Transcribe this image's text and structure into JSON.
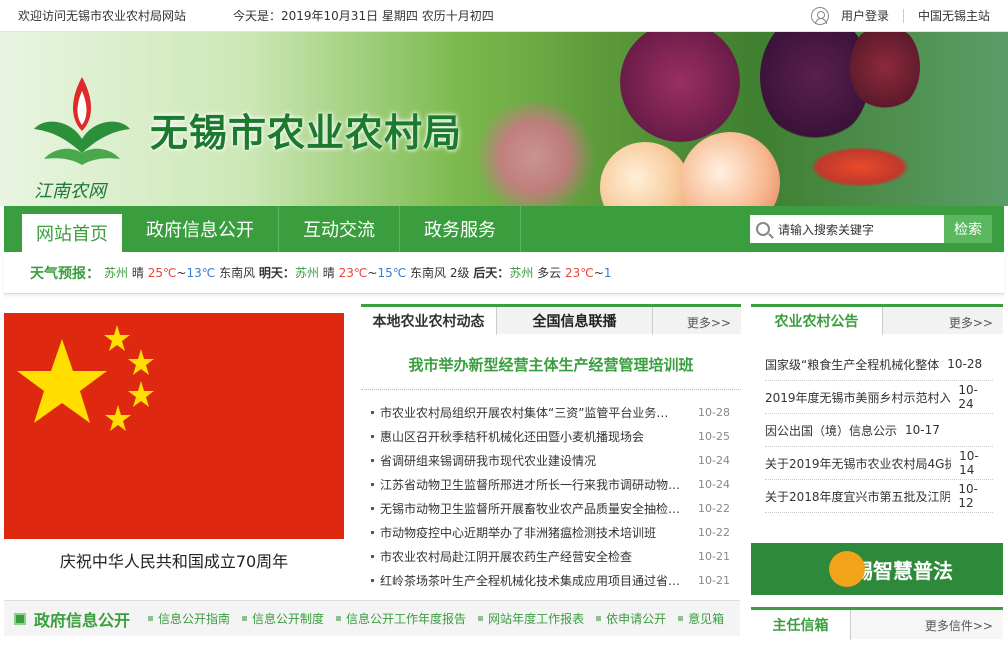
{
  "topbar": {
    "welcome": "欢迎访问无锡市农业农村局网站",
    "date": "今天是：2019年10月31日 星期四 农历十月初四",
    "login": "用户登录",
    "portal": "中国无锡主站"
  },
  "banner": {
    "logo_text": "江南农网",
    "title": "无锡市农业农村局"
  },
  "nav": {
    "items": [
      "网站首页",
      "政府信息公开",
      "互动交流",
      "政务服务"
    ],
    "search_placeholder": "请输入搜索关键字",
    "search_button": "检索"
  },
  "weather": {
    "label": "天气预报：",
    "today": {
      "city": "苏州",
      "cond": "晴",
      "hi": "25℃",
      "lo": "13℃",
      "wind": "东南风"
    },
    "tomorrow": {
      "label": "明天：",
      "city": "苏州",
      "cond": "晴",
      "hi": "23℃",
      "lo": "15℃",
      "wind": "东南风 2级"
    },
    "after": {
      "label": "后天：",
      "city": "苏州",
      "cond": "多云",
      "hi": "23℃",
      "lo": "1"
    }
  },
  "flag": {
    "caption": "庆祝中华人民共和国成立70周年"
  },
  "news": {
    "tabs": [
      "本地农业农村动态",
      "全国信息联播"
    ],
    "more": "更多>>",
    "headline": "我市举办新型经营主体生产经营管理培训班",
    "items": [
      {
        "title": "市农业农村局组织开展农村集体“三资”监管平台业务…",
        "date": "10-28"
      },
      {
        "title": "惠山区召开秋季秸秆机械化还田暨小麦机播现场会",
        "date": "10-25"
      },
      {
        "title": "省调研组来锡调研我市现代农业建设情况",
        "date": "10-24"
      },
      {
        "title": "江苏省动物卫生监督所邢进才所长一行来我市调研动物…",
        "date": "10-24"
      },
      {
        "title": "无锡市动物卫生监督所开展畜牧业农产品质量安全抽检…",
        "date": "10-22"
      },
      {
        "title": "市动物疫控中心近期举办了非洲猪瘟检测技术培训班",
        "date": "10-22"
      },
      {
        "title": "市农业农村局赴江阴开展农药生产经营安全检查",
        "date": "10-21"
      },
      {
        "title": "红岭茶场茶叶生产全程机械化技术集成应用项目通过省…",
        "date": "10-21"
      }
    ]
  },
  "notice": {
    "tab": "农业农村公告",
    "more": "更多>>",
    "items": [
      {
        "title": "国家级“粮食生产全程机械化整体",
        "date": "10-28"
      },
      {
        "title": "2019年度无锡市美丽乡村示范村入",
        "date": "10-24"
      },
      {
        "title": "因公出国（境）信息公示",
        "date": "10-17"
      },
      {
        "title": "关于2019年无锡市农业农村局4G执",
        "date": "10-14"
      },
      {
        "title": "关于2018年度宜兴市第五批及江阴",
        "date": "10-12"
      }
    ]
  },
  "law": {
    "label": "无锡智慧普法"
  },
  "gov": {
    "title": "政府信息公开",
    "links": [
      "信息公开指南",
      "信息公开制度",
      "信息公开工作年度报告",
      "网站年度工作报表",
      "依申请公开",
      "意见箱"
    ]
  },
  "mayor": {
    "tab": "主任信箱",
    "more": "更多信件>>"
  }
}
